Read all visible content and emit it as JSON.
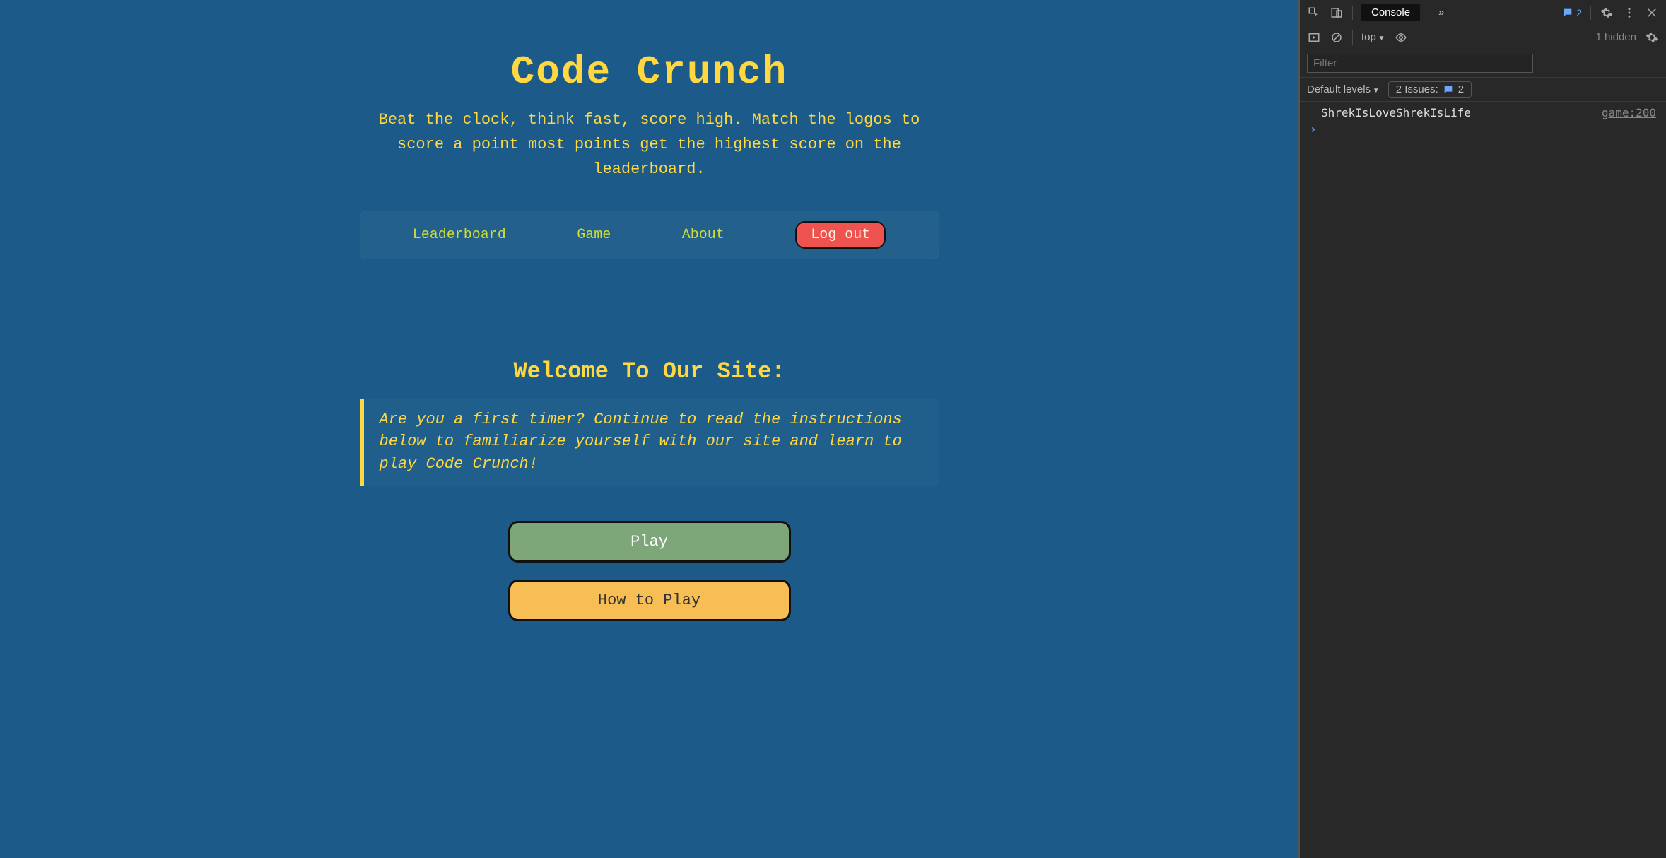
{
  "app": {
    "title": "Code Crunch",
    "subtitle": "Beat the clock, think fast, score high. Match the logos to score a point most points get the highest score on the leaderboard.",
    "nav": {
      "leaderboard": "Leaderboard",
      "game": "Game",
      "about": "About",
      "logout": "Log out"
    },
    "welcome_heading": "Welcome To Our Site:",
    "blurb": "Are you a first timer? Continue to read the instructions below to familiarize yourself with our site and learn to play Code Crunch!",
    "play_button": "Play",
    "howto_button": "How to Play"
  },
  "devtools": {
    "tabs": {
      "console": "Console"
    },
    "more_tabs_glyph": "»",
    "message_badge_count": "2",
    "toolbar": {
      "context": "top",
      "hidden_label": "1 hidden"
    },
    "filter_placeholder": "Filter",
    "levels": {
      "default_levels": "Default levels",
      "issues_label": "2 Issues:",
      "issues_count": "2"
    },
    "console_log": {
      "message": "ShrekIsLoveShrekIsLife",
      "source": "game:200"
    },
    "prompt": "›"
  }
}
